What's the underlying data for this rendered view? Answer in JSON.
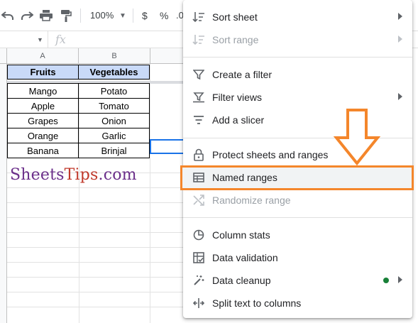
{
  "toolbar": {
    "zoom": "100%",
    "currency_symbol": "$",
    "percent_symbol": "%",
    "decimal_symbol": ".0"
  },
  "formula_bar": {
    "fx_symbol": "fx"
  },
  "grid": {
    "columns": [
      "A",
      "B"
    ],
    "headers": [
      "Fruits",
      "Vegetables"
    ],
    "rows": [
      [
        "Mango",
        "Potato"
      ],
      [
        "Apple",
        "Tomato"
      ],
      [
        "Grapes",
        "Onion"
      ],
      [
        "Orange",
        "Garlic"
      ],
      [
        "Banana",
        "Brinjal"
      ]
    ]
  },
  "watermark": {
    "part1": "Sheets",
    "part2": "Tips",
    "part3": ".com"
  },
  "menu": {
    "items": [
      {
        "label": "Sort sheet",
        "icon": "sort-icon",
        "submenu": true,
        "disabled": false
      },
      {
        "label": "Sort range",
        "icon": "sort-icon",
        "submenu": true,
        "disabled": true
      },
      {
        "label": "Create a filter",
        "icon": "filter-icon",
        "submenu": false,
        "disabled": false
      },
      {
        "label": "Filter views",
        "icon": "filter-views-icon",
        "submenu": true,
        "disabled": false
      },
      {
        "label": "Add a slicer",
        "icon": "slicer-icon",
        "submenu": false,
        "disabled": false
      },
      {
        "label": "Protect sheets and ranges",
        "icon": "lock-icon",
        "submenu": false,
        "disabled": false
      },
      {
        "label": "Named ranges",
        "icon": "named-ranges-icon",
        "submenu": false,
        "disabled": false,
        "highlighted": true
      },
      {
        "label": "Randomize range",
        "icon": "shuffle-icon",
        "submenu": false,
        "disabled": true
      },
      {
        "label": "Column stats",
        "icon": "column-stats-icon",
        "submenu": false,
        "disabled": false
      },
      {
        "label": "Data validation",
        "icon": "data-validation-icon",
        "submenu": false,
        "disabled": false
      },
      {
        "label": "Data cleanup",
        "icon": "magic-wand-icon",
        "submenu": true,
        "disabled": false,
        "new_indicator": true
      },
      {
        "label": "Split text to columns",
        "icon": "split-columns-icon",
        "submenu": false,
        "disabled": false
      }
    ]
  },
  "colors": {
    "header_fill": "#c9daf8",
    "highlight_border": "#f4862b",
    "new_dot": "#188038",
    "selection": "#1a73e8"
  }
}
